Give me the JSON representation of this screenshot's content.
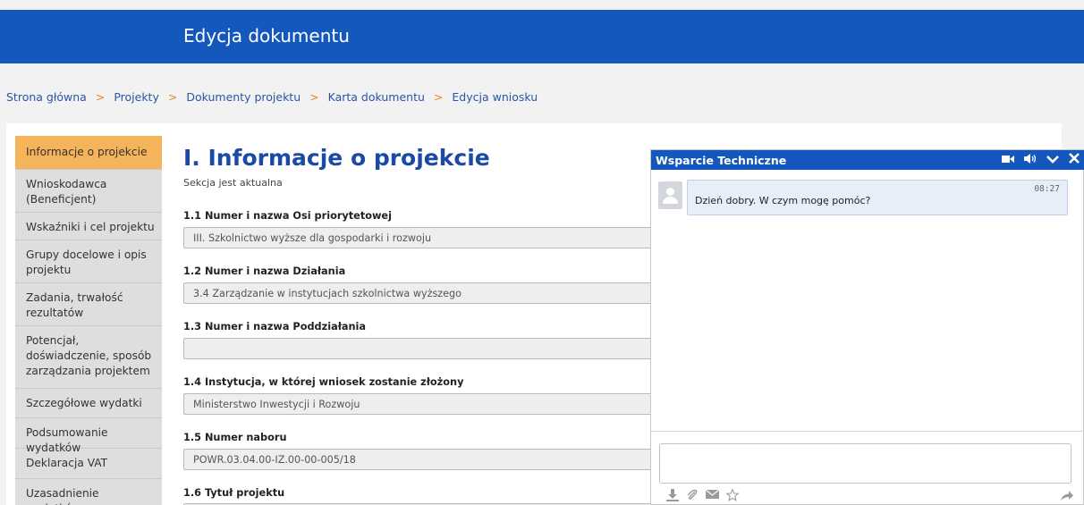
{
  "header": {
    "title": "Edycja dokumentu"
  },
  "breadcrumb": {
    "items": [
      "Strona główna",
      "Projekty",
      "Dokumenty projektu",
      "Karta dokumentu",
      "Edycja wniosku"
    ],
    "separator": ">"
  },
  "sidebar": {
    "items": [
      {
        "label": "Informacje o projekcie",
        "active": true
      },
      {
        "label": "Wnioskodawca (Beneficjent)"
      },
      {
        "label": "Wskaźniki i cel projektu"
      },
      {
        "label": "Grupy docelowe i opis projektu"
      },
      {
        "label": "Zadania, trwałość rezultatów"
      },
      {
        "label": "Potencjał, doświadczenie, sposób zarządzania projektem"
      },
      {
        "label": "Szczegółowe wydatki"
      },
      {
        "label": "Podsumowanie wydatków"
      },
      {
        "label": "Deklaracja VAT"
      },
      {
        "label": "Uzasadnienie wydatków"
      }
    ]
  },
  "form": {
    "title": "I. Informacje o projekcie",
    "status": "Sekcja jest aktualna",
    "fields": [
      {
        "label": "1.1 Numer i nazwa Osi priorytetowej",
        "value": "III. Szkolnictwo wyższe dla gospodarki i rozwoju"
      },
      {
        "label": "1.2 Numer i nazwa Działania",
        "value": "3.4 Zarządzanie w instytucjach szkolnictwa wyższego"
      },
      {
        "label": "1.3 Numer i nazwa Poddziałania",
        "value": ""
      },
      {
        "label": "1.4 Instytucja, w której wniosek zostanie złożony",
        "value": "Ministerstwo Inwestycji i Rozwoju"
      },
      {
        "label": "1.5 Numer naboru",
        "value": "POWR.03.04.00-IZ.00-00-005/18"
      },
      {
        "label": "1.6 Tytuł projektu",
        "value": ""
      }
    ]
  },
  "chat": {
    "title": "Wsparcie Techniczne",
    "header_icons": [
      "video-icon",
      "speaker-icon",
      "minimize-icon",
      "close-icon"
    ],
    "messages": [
      {
        "time": "08:27",
        "text": "Dzień dobry. W czym mogę pomóc?"
      }
    ],
    "input_value": "",
    "tool_icons": [
      "download-icon",
      "attach-icon",
      "email-icon",
      "star-icon"
    ],
    "send_icon": "send-icon"
  },
  "colors": {
    "brand_blue": "#1558bd",
    "active_tab": "#f5b35a",
    "title_blue": "#1a4aa5",
    "breadcrumb_separator": "#e38a1a"
  }
}
